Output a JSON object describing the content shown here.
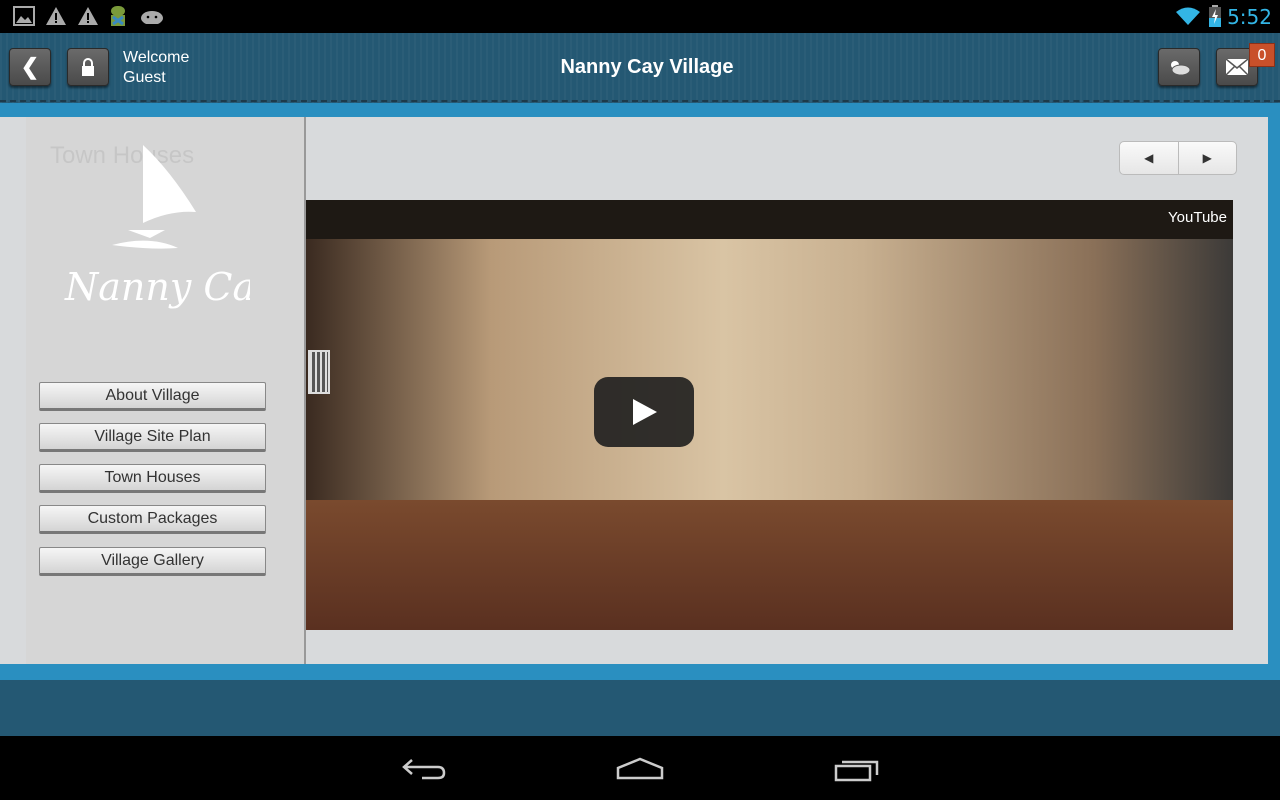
{
  "status_bar": {
    "time": "5:52",
    "icons": [
      "image-icon",
      "warning-icon",
      "warning-icon",
      "android-icon",
      "android-head-icon",
      "wifi-icon",
      "battery-charging-icon"
    ]
  },
  "header": {
    "welcome_line1": "Welcome",
    "welcome_line2": "Guest",
    "title": "Nanny Cay Village",
    "mail_count": "0"
  },
  "sidebar": {
    "ghost_heading": "Town Houses",
    "logo_text": "Nanny Cay",
    "items": [
      {
        "label": "About Village"
      },
      {
        "label": "Village Site Plan"
      },
      {
        "label": "Town Houses"
      },
      {
        "label": "Custom Packages"
      },
      {
        "label": "Village Gallery"
      }
    ]
  },
  "video": {
    "provider": "YouTube"
  },
  "colors": {
    "header": "#245873",
    "accent": "#2a8fc0",
    "badge": "#c9502a",
    "clock": "#33b5e5"
  }
}
